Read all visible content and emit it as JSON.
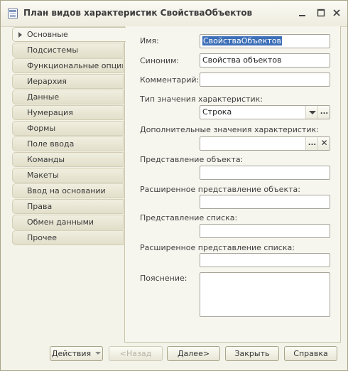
{
  "window": {
    "title": "План видов характеристик СвойстваОбъектов"
  },
  "tabs": [
    {
      "label": "Основные",
      "active": true
    },
    {
      "label": "Подсистемы"
    },
    {
      "label": "Функциональные опции"
    },
    {
      "label": "Иерархия"
    },
    {
      "label": "Данные"
    },
    {
      "label": "Нумерация"
    },
    {
      "label": "Формы"
    },
    {
      "label": "Поле ввода"
    },
    {
      "label": "Команды"
    },
    {
      "label": "Макеты"
    },
    {
      "label": "Ввод на основании"
    },
    {
      "label": "Права"
    },
    {
      "label": "Обмен данными"
    },
    {
      "label": "Прочее"
    }
  ],
  "form": {
    "name_label": "Имя:",
    "name_value": "СвойстваОбъектов",
    "synonym_label": "Синоним:",
    "synonym_value": "Свойства объектов",
    "comment_label": "Комментарий:",
    "comment_value": "",
    "value_type_label": "Тип значения характеристик:",
    "value_type_value": "Строка",
    "extra_values_label": "Дополнительные значения характеристик:",
    "extra_values_value": "",
    "object_repr_label": "Представление объекта:",
    "object_repr_value": "",
    "ext_object_repr_label": "Расширенное представление объекта:",
    "ext_object_repr_value": "",
    "list_repr_label": "Представление списка:",
    "list_repr_value": "",
    "ext_list_repr_label": "Расширенное представление списка:",
    "ext_list_repr_value": "",
    "explanation_label": "Пояснение:",
    "explanation_value": ""
  },
  "buttons": {
    "actions": "Действия",
    "back": "<Назад",
    "next": "Далее>",
    "close": "Закрыть",
    "help": "Справка"
  },
  "icons": {
    "window": "document-list-icon",
    "minimize": "minimize-icon",
    "maximize": "maximize-icon",
    "close": "close-icon"
  }
}
